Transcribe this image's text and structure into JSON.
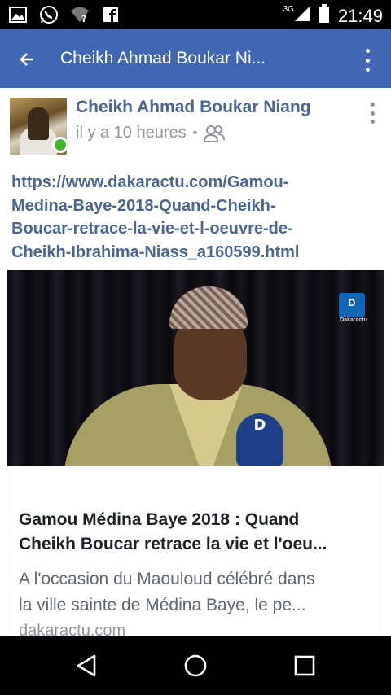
{
  "status_bar": {
    "network": "3G",
    "time": "21:49"
  },
  "app_bar": {
    "title": "Cheikh Ahmad Boukar Ni..."
  },
  "post": {
    "author": "Cheikh Ahmad Boukar Niang",
    "time_ago": "il y a 10 heures",
    "separator": "•",
    "audience_icon": "friends-icon",
    "link_lines": [
      "https://www.dakaractu.com/Gamou-",
      "Medina-Baye-2018-Quand-Cheikh-",
      "Boucar-retrace-la-vie-et-l-oeuvre-de-",
      "Cheikh-Ibrahima-Niass_a160599.html"
    ]
  },
  "preview": {
    "logo_text": "D",
    "logo_sub": "Dakaractu",
    "mic_text": "D"
  },
  "link_card": {
    "title_lines": [
      "Gamou Médina Baye 2018 : Quand",
      "Cheikh Boucar retrace la vie et l'oeu..."
    ],
    "desc_lines": [
      "A l'occasion du Maouloud célébré dans",
      "la ville sainte de Médina Baye, le pe..."
    ],
    "domain": "dakaractu.com"
  },
  "colors": {
    "app_bar": "#4267b2",
    "link": "#4b6594",
    "online": "#42b72a"
  }
}
